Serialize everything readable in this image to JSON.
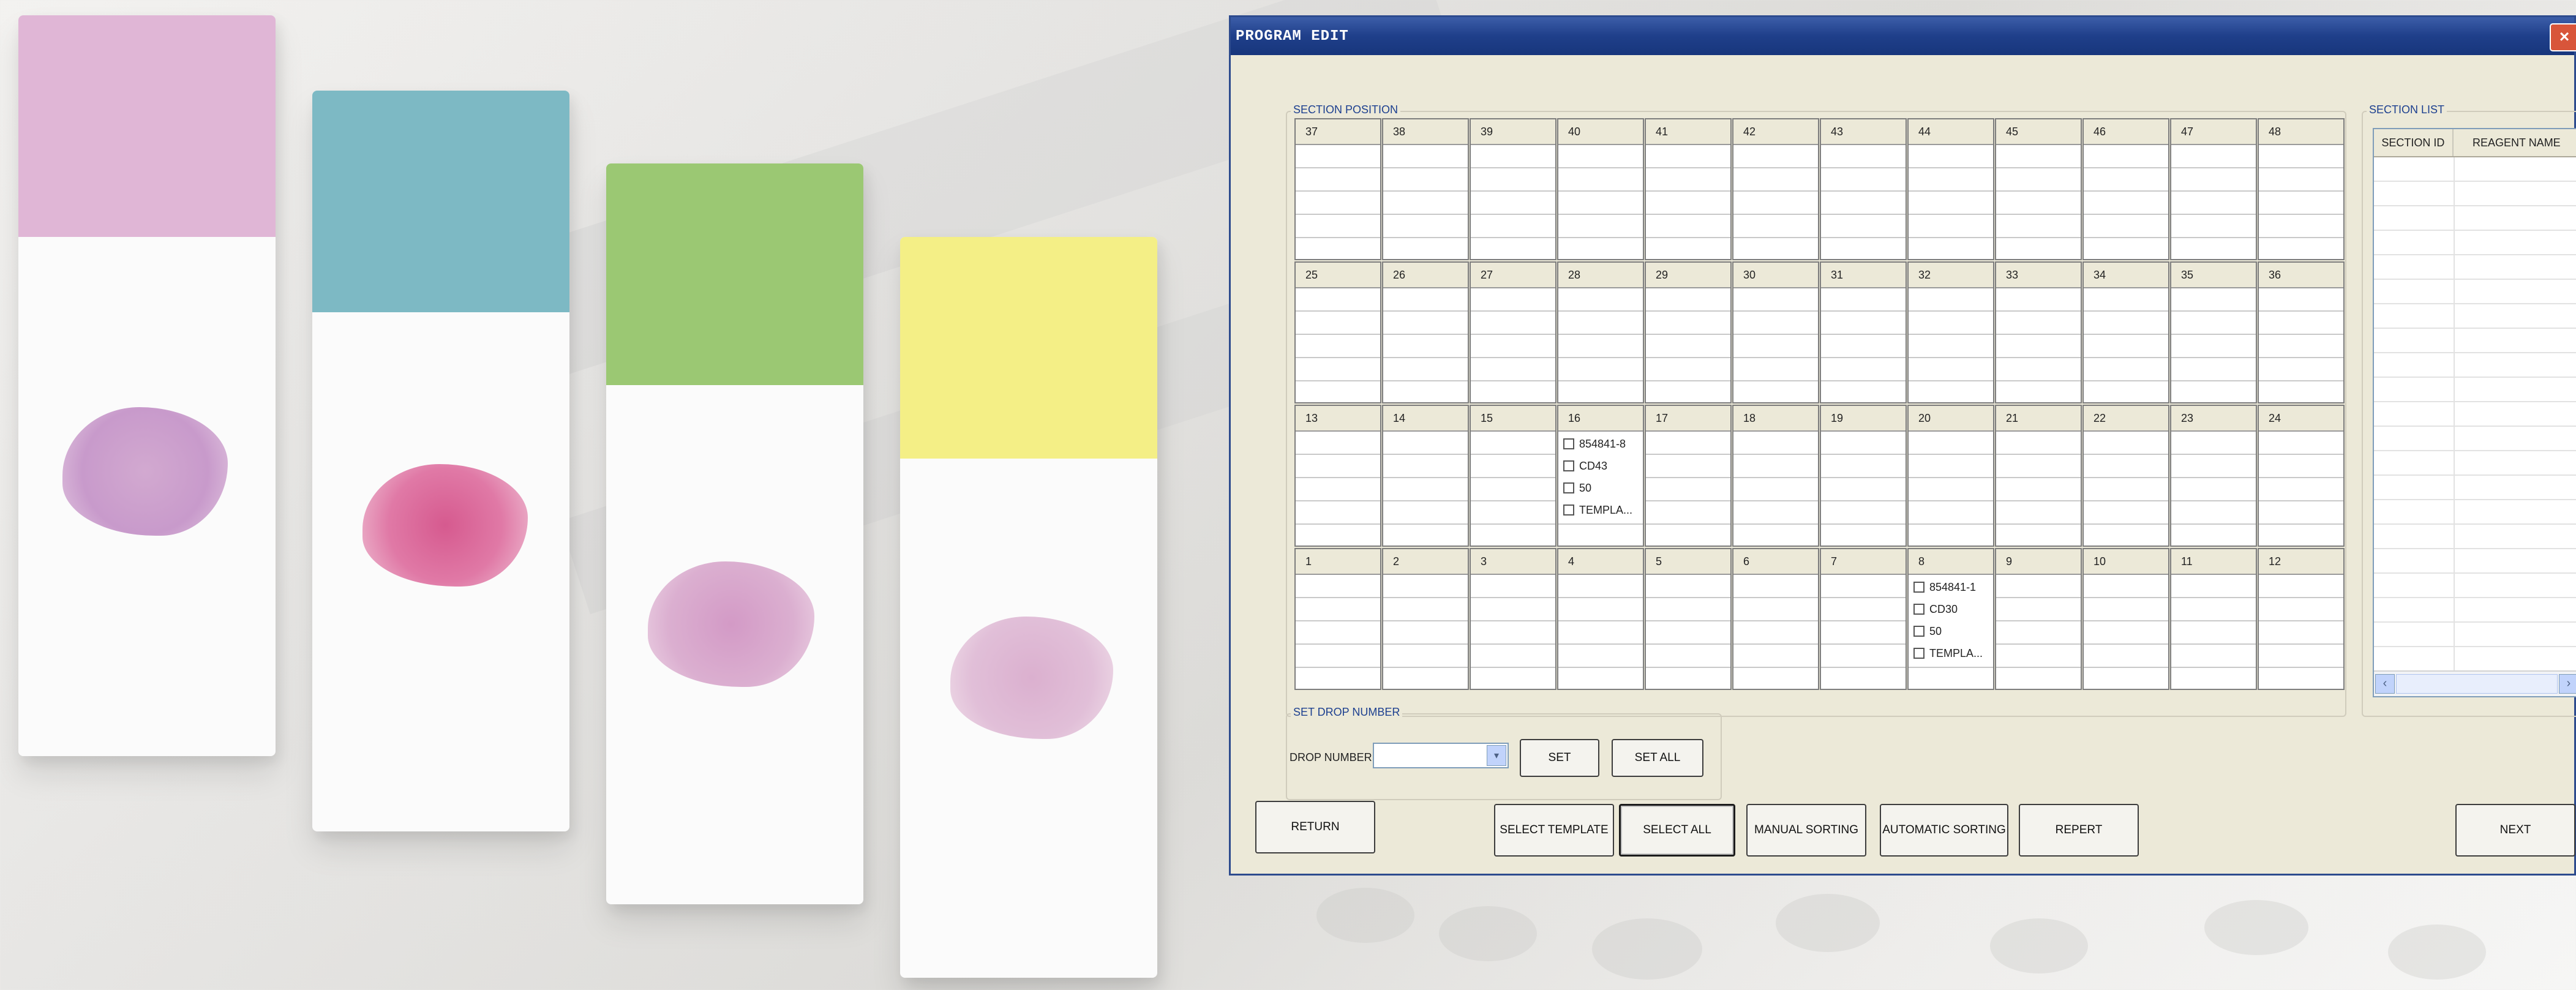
{
  "window": {
    "title": "PROGRAM EDIT",
    "close_symbol": "×"
  },
  "section_position": {
    "legend": "SECTION POSITION",
    "rows": [
      {
        "cells": [
          {
            "label": "37"
          },
          {
            "label": "38"
          },
          {
            "label": "39"
          },
          {
            "label": "40"
          },
          {
            "label": "41"
          },
          {
            "label": "42"
          },
          {
            "label": "43"
          },
          {
            "label": "44"
          },
          {
            "label": "45"
          },
          {
            "label": "46"
          },
          {
            "label": "47"
          },
          {
            "label": "48"
          }
        ]
      },
      {
        "cells": [
          {
            "label": "25"
          },
          {
            "label": "26"
          },
          {
            "label": "27"
          },
          {
            "label": "28"
          },
          {
            "label": "29"
          },
          {
            "label": "30"
          },
          {
            "label": "31"
          },
          {
            "label": "32"
          },
          {
            "label": "33"
          },
          {
            "label": "34"
          },
          {
            "label": "35"
          },
          {
            "label": "36"
          }
        ]
      },
      {
        "cells": [
          {
            "label": "13"
          },
          {
            "label": "14"
          },
          {
            "label": "15"
          },
          {
            "label": "16",
            "items": [
              "854841-8",
              "CD43",
              "50",
              "TEMPLA..."
            ]
          },
          {
            "label": "17"
          },
          {
            "label": "18"
          },
          {
            "label": "19"
          },
          {
            "label": "20"
          },
          {
            "label": "21"
          },
          {
            "label": "22"
          },
          {
            "label": "23"
          },
          {
            "label": "24"
          }
        ]
      },
      {
        "cells": [
          {
            "label": "1"
          },
          {
            "label": "2"
          },
          {
            "label": "3"
          },
          {
            "label": "4"
          },
          {
            "label": "5"
          },
          {
            "label": "6"
          },
          {
            "label": "7"
          },
          {
            "label": "8",
            "items": [
              "854841-1",
              "CD30",
              "50",
              "TEMPLA..."
            ]
          },
          {
            "label": "9"
          },
          {
            "label": "10"
          },
          {
            "label": "11"
          },
          {
            "label": "12"
          }
        ]
      }
    ]
  },
  "set_drop": {
    "legend": "SET DROP NUMBER",
    "drop_label": "DROP NUMBER",
    "drop_value": "",
    "set_label": "SET",
    "set_all_label": "SET ALL"
  },
  "section_list": {
    "legend": "SECTION LIST",
    "columns": [
      "SECTION ID",
      "REAGENT NAME"
    ]
  },
  "buttons": {
    "return": "RETURN",
    "select_template": "SELECT TEMPLATE",
    "select_all": "SELECT ALL",
    "manual_sorting": "MANUAL SORTING",
    "automatic_sorting": "AUTOMATIC SORTING",
    "repert": "REPERT",
    "next": "NEXT"
  },
  "icons": {
    "scroll_left": "‹",
    "scroll_right": "›",
    "dropdown": "▾"
  },
  "colors": {
    "slide_labels": [
      "#e0b6d6",
      "#7db9c4",
      "#9bc873",
      "#f4ef86"
    ],
    "window_frame": "#2d4b8e",
    "window_bg": "#ece9d8"
  }
}
